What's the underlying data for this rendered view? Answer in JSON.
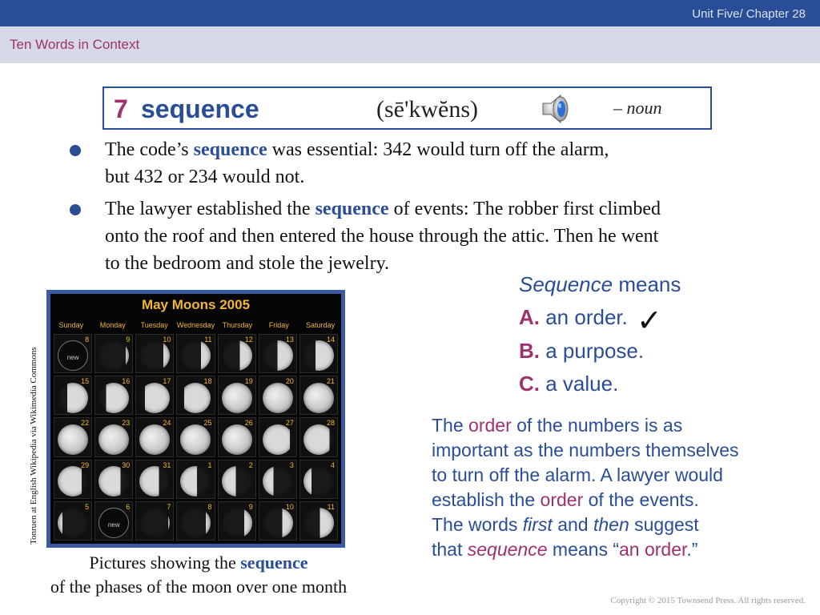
{
  "header": {
    "unit": "Unit Five/ Chapter 28",
    "section": "Ten Words in Context"
  },
  "word": {
    "number": "7",
    "term": "sequence",
    "pronunciation": "(sē'kwĕns)",
    "part_of_speech": "– noun",
    "speaker_icon": "speaker-icon"
  },
  "sentences": [
    {
      "lines": [
        {
          "before": "The code’s ",
          "highlight": "sequence",
          "after": " was essential: 342 would turn off the alarm,"
        },
        {
          "text": "but 432 or 234 would not."
        }
      ]
    },
    {
      "lines": [
        {
          "before": "The lawyer established the ",
          "highlight": "sequence",
          "after": " of events: The robber first climbed"
        },
        {
          "text": "onto the roof and then entered the house through the attic. Then he went"
        },
        {
          "text": "to the bedroom and stole the jewelry."
        }
      ]
    }
  ],
  "calendar": {
    "title": "May Moons 2005",
    "days": [
      "Sunday",
      "Monday",
      "Tuesday",
      "Wednesday",
      "Thursday",
      "Friday",
      "Saturday"
    ],
    "weeks": [
      [
        "8",
        "9",
        "10",
        "11",
        "12",
        "13",
        "14"
      ],
      [
        "15",
        "16",
        "17",
        "18",
        "19",
        "20",
        "21"
      ],
      [
        "22",
        "23",
        "24",
        "25",
        "26",
        "27",
        "28"
      ],
      [
        "29",
        "30",
        "31",
        "1",
        "2",
        "3",
        "4"
      ],
      [
        "5",
        "6",
        "7",
        "8",
        "9",
        "10",
        "11"
      ]
    ],
    "new_label": "new",
    "new_moon_cells": [
      "0-0",
      "4-1"
    ],
    "photo_credit": "Tonruen at English Wikipedia via Wikimedia Commons"
  },
  "caption": {
    "line1_before": "Pictures showing the ",
    "line1_highlight": "sequence",
    "line2": "of the phases of the moon over one month"
  },
  "question": {
    "prompt_italic": "Sequence",
    "prompt_rest": " means",
    "options": [
      {
        "letter": "A.",
        "text": " an order."
      },
      {
        "letter": "B.",
        "text": " a purpose."
      },
      {
        "letter": "C.",
        "text": " a value."
      }
    ],
    "check_mark": "✓"
  },
  "explanation": {
    "line1_a": "The ",
    "line1_b": "order",
    "line1_c": " of the numbers is as",
    "line2": "important as the numbers themselves",
    "line3": "to turn off the alarm. A lawyer would",
    "line4_a": "establish the ",
    "line4_b": "order",
    "line4_c": " of the events.",
    "line5_a": "The words ",
    "line5_b": "first",
    "line5_c": " and ",
    "line5_d": "then",
    "line5_e": " suggest",
    "line6_a": "that ",
    "line6_b": "sequence",
    "line6_c": " means “",
    "line6_d": "an order",
    "line6_e": ".”"
  },
  "footer": {
    "copyright": "Copyright © 2015 Townsend Press. All rights reserved."
  },
  "colors": {
    "brand_blue": "#2a4d97",
    "accent_magenta": "#a0306e",
    "calendar_gold": "#f2b632"
  }
}
